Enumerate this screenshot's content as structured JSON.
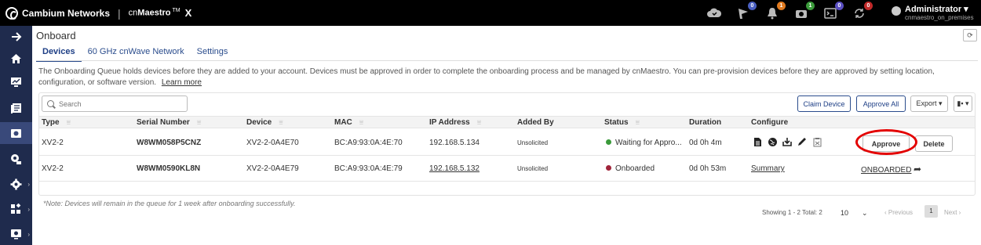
{
  "brand": {
    "company": "Cambium Networks",
    "product_prefix": "cn",
    "product_name": "Maestro",
    "tm": "TM",
    "x": "X"
  },
  "topbar": {
    "icons": [
      {
        "name": "cloud-icon",
        "badge": null
      },
      {
        "name": "flag-icon",
        "badge": "0",
        "badge_color": "#4a5fc1"
      },
      {
        "name": "bell-icon",
        "badge": "1",
        "badge_color": "#e07a1f"
      },
      {
        "name": "camera-icon",
        "badge": "1",
        "badge_color": "#3a9a3a"
      },
      {
        "name": "terminal-icon",
        "badge": "0",
        "badge_color": "#5a4fc1"
      },
      {
        "name": "sync-icon",
        "badge": "0",
        "badge_color": "#c12a2a"
      }
    ],
    "user": {
      "name": "Administrator ▾",
      "account": "cnmaestro_on_premises"
    }
  },
  "page": {
    "title": "Onboard",
    "refresh": "⟳"
  },
  "tabs": [
    {
      "label": "Devices",
      "active": true
    },
    {
      "label": "60 GHz cnWave Network",
      "active": false
    },
    {
      "label": "Settings",
      "active": false
    }
  ],
  "description": {
    "text": "The Onboarding Queue holds devices before they are added to your account. Devices must be approved in order to complete the onboarding process and be managed by cnMaestro. You can pre-provision devices before they are approved by setting location, configuration, or software version.",
    "link": "Learn more"
  },
  "toolbar": {
    "search_placeholder": "Search",
    "claim_device": "Claim Device",
    "approve_all": "Approve All",
    "export": "Export ▾",
    "columns": "▮▪ ▾"
  },
  "table": {
    "headers": [
      "Type",
      "Serial Number",
      "Device",
      "MAC",
      "IP Address",
      "Added By",
      "Status",
      "Duration",
      "Configure"
    ],
    "rows": [
      {
        "type": "XV2-2",
        "serial": "W8WM058P5CNZ",
        "device": "XV2-2-0A4E70",
        "mac": "BC:A9:93:0A:4E:70",
        "ip": "192.168.5.134",
        "added_by": "Unsolicited",
        "status": "Waiting for Appro...",
        "status_color": "#3a9a3a",
        "duration": "0d 0h 4m",
        "approve": "Approve",
        "delete": "Delete"
      },
      {
        "type": "XV2-2",
        "serial": "W8WM0590KL8N",
        "device": "XV2-2-0A4E79",
        "mac": "BC:A9:93:0A:4E:79",
        "ip": "192.168.5.132",
        "added_by": "Unsolicited",
        "status": "Onboarded",
        "status_color": "#a0243a",
        "duration": "0d 0h 53m",
        "configure": "Summary",
        "onboarded": "ONBOARDED",
        "onboarded_arrow": "➦"
      }
    ]
  },
  "pagination": {
    "summary": "Showing 1 - 2 Total: 2",
    "page_size": "10",
    "previous": "‹ Previous",
    "page": "1",
    "next": "Next ›"
  },
  "note": "*Note: Devices will remain in the queue for 1 week after onboarding successfully."
}
